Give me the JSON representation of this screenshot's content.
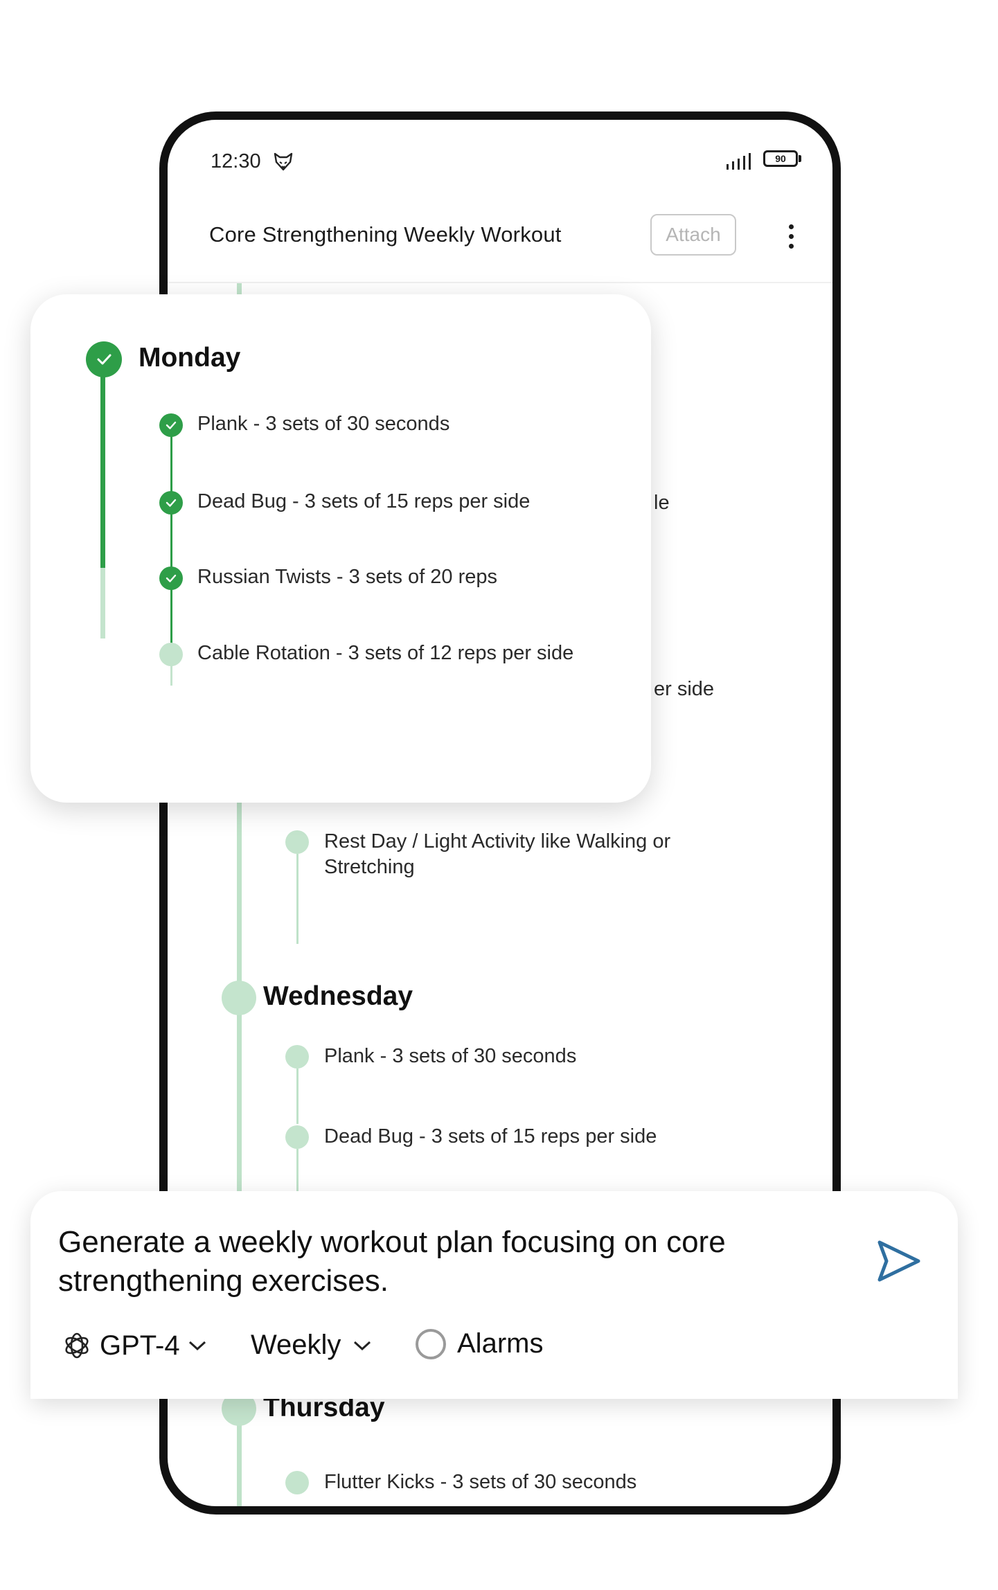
{
  "status_bar": {
    "time": "12:30",
    "battery": "90"
  },
  "header": {
    "title": "Core Strengthening Weekly Workout",
    "attach_label": "Attach"
  },
  "background_plan": {
    "partial_texts": [
      "le",
      "er side"
    ],
    "tuesday_exercise": "Rest Day / Light Activity like Walking or Stretching",
    "wednesday": {
      "day": "Wednesday",
      "exercises": [
        "Plank - 3 sets of 30 seconds",
        "Dead Bug - 3 sets of 15 reps per side"
      ]
    },
    "thursday": {
      "day": "Thursday",
      "exercises": [
        "Flutter Kicks - 3 sets of 30 seconds"
      ]
    }
  },
  "monday_card": {
    "day": "Monday",
    "exercises": [
      {
        "label": "Plank - 3 sets of 30 seconds",
        "done": true
      },
      {
        "label": "Dead Bug - 3 sets of 15 reps per side",
        "done": true
      },
      {
        "label": "Russian Twists - 3 sets of 20 reps",
        "done": true
      },
      {
        "label": "Cable Rotation - 3 sets of 12 reps per side",
        "done": false
      }
    ]
  },
  "prompt": {
    "text": "Generate a weekly workout plan focusing on core strengthening exercises.",
    "model": "GPT-4",
    "period": "Weekly",
    "alarms_label": "Alarms"
  },
  "colors": {
    "done_green": "#2e9e48",
    "pending_green": "#c4e4cd",
    "send_blue": "#2f6fa0"
  }
}
